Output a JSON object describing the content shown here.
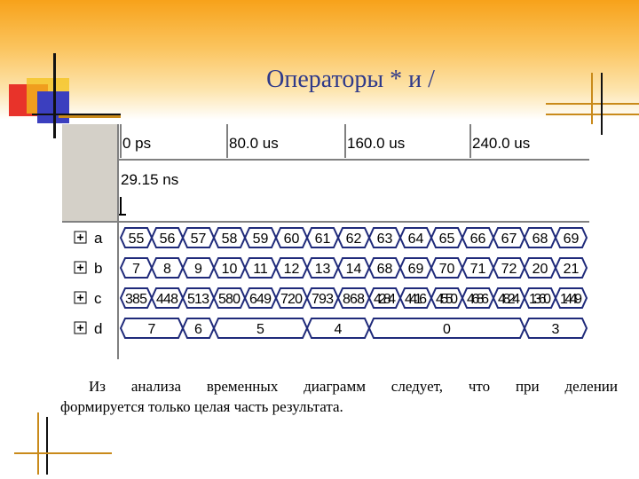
{
  "title": "Операторы * и /",
  "caption": {
    "line1": "Из анализа временных диаграмм следует, что при делении",
    "line2": "формируется только целая часть результата."
  },
  "waveform": {
    "time_labels": [
      "0 ps",
      "80.0 us",
      "160.0 us",
      "240.0 us"
    ],
    "cursor_time": "29.15 ns",
    "signals": [
      {
        "name": "a",
        "values": [
          "55",
          "56",
          "57",
          "58",
          "59",
          "60",
          "61",
          "62",
          "63",
          "64",
          "65",
          "66",
          "67",
          "68",
          "69"
        ]
      },
      {
        "name": "b",
        "values": [
          "7",
          "8",
          "9",
          "10",
          "11",
          "12",
          "13",
          "14",
          "68",
          "69",
          "70",
          "71",
          "72",
          "20",
          "21"
        ]
      },
      {
        "name": "c",
        "values": [
          "385",
          "448",
          "513",
          "580",
          "649",
          "720",
          "793",
          "868",
          "4284",
          "4416",
          "4550",
          "4686",
          "4824",
          "1360",
          "1449"
        ]
      },
      {
        "name": "d",
        "values": [
          "7",
          "7",
          "6",
          "5",
          "5",
          "5",
          "4",
          "4",
          "0",
          "0",
          "0",
          "0",
          "0",
          "3",
          "3"
        ]
      }
    ]
  },
  "colors": {
    "title": "#2f3a8a",
    "wave_line": "#1f2a7a",
    "header_bg": "#d4d0c8",
    "deco_red": "#e8332a",
    "deco_blue": "#3b3fbf",
    "deco_yellow": "#f3c31b"
  }
}
